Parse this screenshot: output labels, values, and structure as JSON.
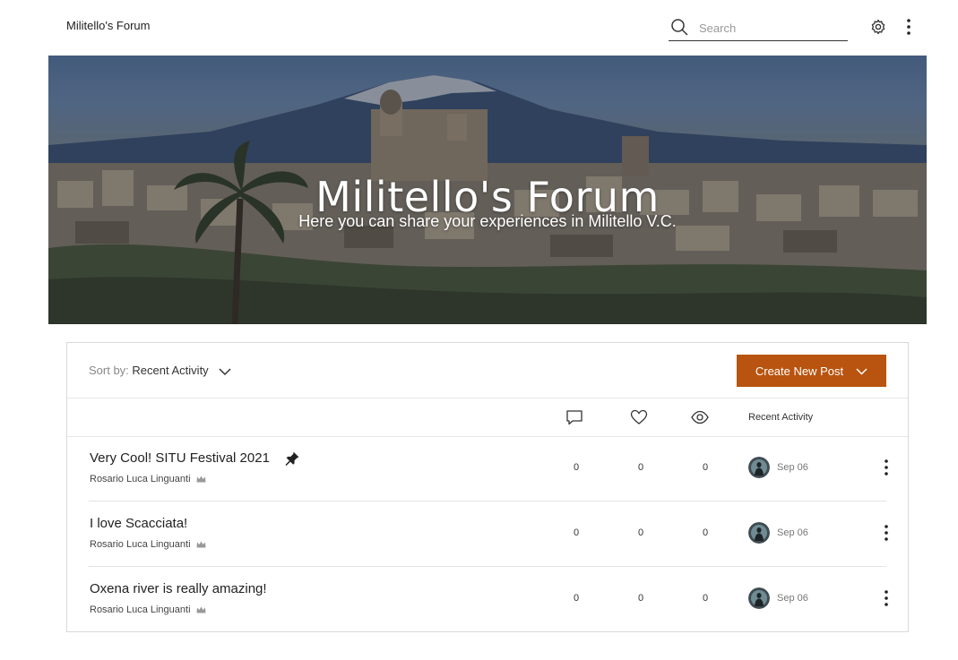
{
  "header": {
    "site_title": "Militello's Forum",
    "search_placeholder": "Search"
  },
  "hero": {
    "title": "Militello's Forum",
    "subtitle": "Here you can share your experiences in Militello V.C."
  },
  "toolbar": {
    "sort_prefix": "Sort by:",
    "sort_value": "Recent Activity",
    "create_button_label": "Create New Post"
  },
  "columns": {
    "comments_icon": "comment-icon",
    "likes_icon": "heart-icon",
    "views_icon": "eye-icon",
    "recent_activity_label": "Recent Activity"
  },
  "posts": [
    {
      "title": "Very Cool! SITU Festival 2021",
      "pinned": true,
      "author": "Rosario Luca Linguanti",
      "comments": "0",
      "likes": "0",
      "views": "0",
      "date": "Sep 06"
    },
    {
      "title": "I love Scacciata!",
      "pinned": false,
      "author": "Rosario Luca Linguanti",
      "comments": "0",
      "likes": "0",
      "views": "0",
      "date": "Sep 06"
    },
    {
      "title": "Oxena river is really amazing!",
      "pinned": false,
      "author": "Rosario Luca Linguanti",
      "comments": "0",
      "likes": "0",
      "views": "0",
      "date": "Sep 06"
    }
  ],
  "colors": {
    "accent": "#b8540f",
    "border": "#d9d9d9"
  }
}
